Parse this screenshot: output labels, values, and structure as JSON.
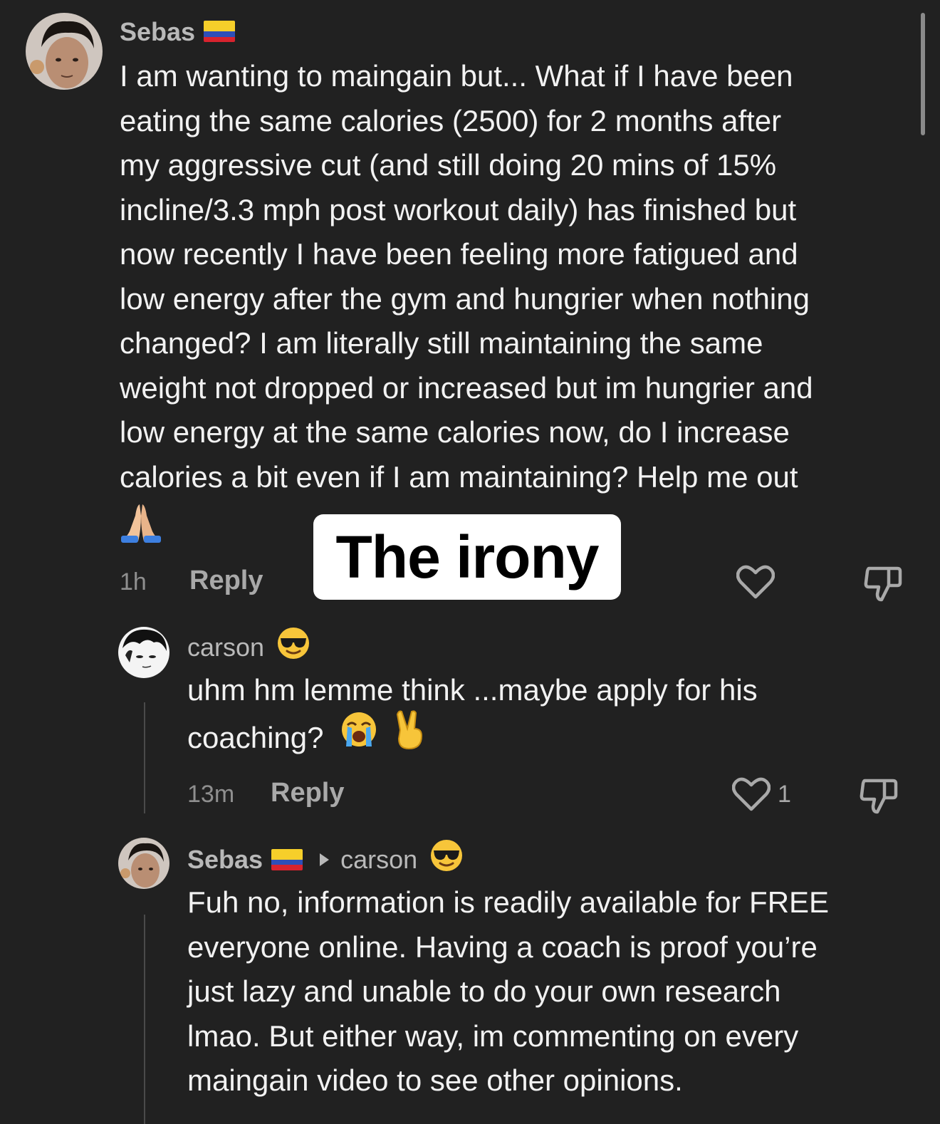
{
  "comments": [
    {
      "username": "Sebas",
      "text_lines": [
        "I am wanting to maingain but... What if I have been",
        "eating the same calories (2500) for 2 months after",
        "my aggressive cut (and still doing 20 mins of 15%",
        "incline/3.3 mph post workout daily) has finished but",
        "now recently I have been feeling more fatigued and",
        "low energy after the gym and hungrier when nothing",
        "changed? I am literally still maintaining the same",
        "weight not dropped or increased but im hungrier and",
        "low energy at the same calories now, do I increase",
        "calories a bit even if I am maintaining? Help me out"
      ],
      "time": "1h",
      "reply_label": "Reply"
    },
    {
      "username": "carson",
      "text_lines": [
        "uhm hm lemme think ...maybe apply for his",
        "coaching?"
      ],
      "time": "13m",
      "reply_label": "Reply",
      "like_count": "1"
    },
    {
      "username": "Sebas",
      "reply_to": "carson",
      "text_lines": [
        "Fuh no, information is readily available for FREE",
        "everyone online. Having a coach is proof you’re",
        "just lazy and unable to do your own research",
        "lmao. But either way, im commenting on every",
        "maingain video to see other opinions."
      ]
    }
  ],
  "overlay": {
    "caption": "The irony"
  },
  "colors": {
    "background": "#212121",
    "text": "#f2f2f2",
    "username": "#b9b9b9",
    "muted": "#8f8f8f",
    "overlay_bg": "#ffffff"
  },
  "icons": {
    "flag": "colombia-flag-icon",
    "sunglasses": "sunglasses-emoji-icon",
    "crying": "loudly-crying-emoji-icon",
    "peace": "victory-hand-emoji-icon",
    "pray": "folded-hands-emoji-icon",
    "like": "heart-outline-icon",
    "dislike": "thumbs-down-outline-icon"
  }
}
